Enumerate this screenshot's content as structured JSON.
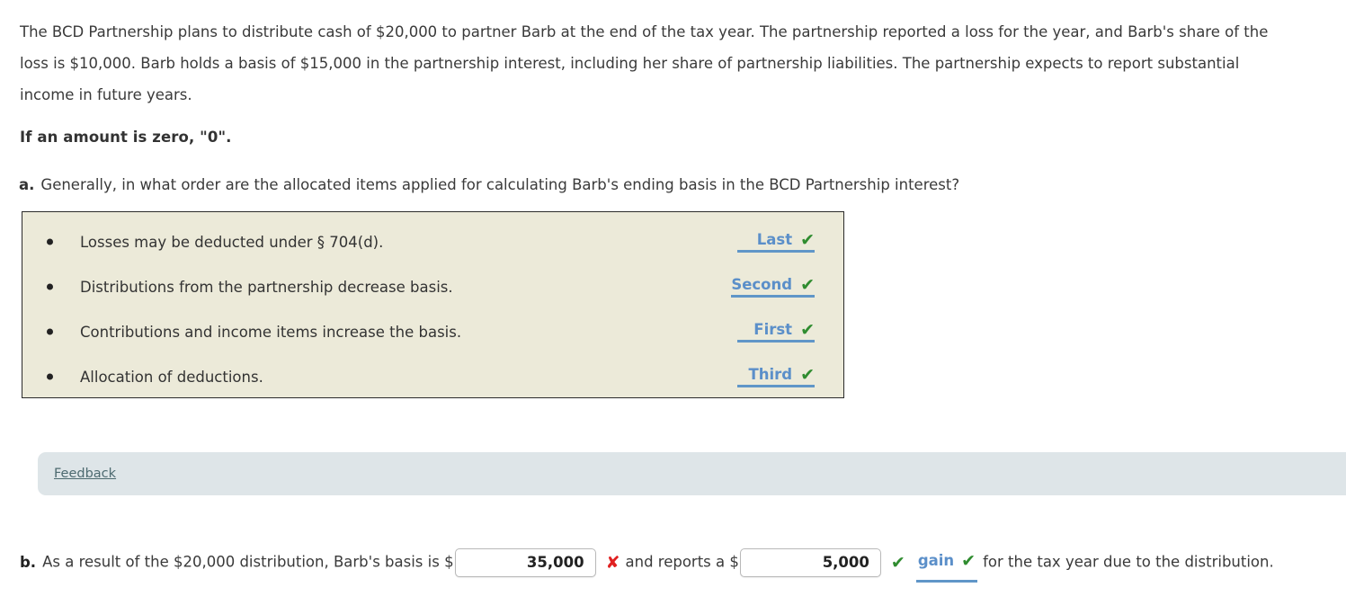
{
  "problem": {
    "intro": "The BCD Partnership plans to distribute cash of $20,000 to partner Barb at the end of the tax year. The partnership reported a loss for the year, and Barb's share of the loss is $10,000. Barb holds a basis of $15,000 in the partnership interest, including her share of partnership liabilities. The partnership expects to report substantial income in future years.",
    "instruction": "If an amount is zero, \"0\"."
  },
  "part_a": {
    "label": "a.",
    "question": "Generally, in what order are the allocated items applied for calculating Barb's ending basis in the BCD Partnership interest?",
    "items": [
      {
        "text": "Losses may be deducted under § 704(d).",
        "answer": "Last",
        "status": "correct",
        "status_glyph": "✔"
      },
      {
        "text": "Distributions from the partnership decrease basis.",
        "answer": "Second",
        "status": "correct",
        "status_glyph": "✔"
      },
      {
        "text": "Contributions and income items increase the basis.",
        "answer": "First",
        "status": "correct",
        "status_glyph": "✔"
      },
      {
        "text": "Allocation of deductions.",
        "answer": "Third",
        "status": "correct",
        "status_glyph": "✔"
      }
    ]
  },
  "feedback": {
    "label": "Feedback"
  },
  "part_b": {
    "label": "b.",
    "text_1": "As a result of the $20,000 distribution, Barb's basis is $",
    "basis_value": "35,000",
    "basis_status_glyph": "✘",
    "text_2": "and reports a $",
    "gain_value": "5,000",
    "gain_status_glyph": "✔",
    "gain_type": "gain",
    "gain_type_status_glyph": "✔",
    "text_3": "for the tax year due to the distribution."
  },
  "colors": {
    "answer_box_bg": "#ECEAD9",
    "answer_box_border": "#2B2B2B",
    "dropdown_blue": "#5B8FC9",
    "dropdown_underline": "#6096C8",
    "check_green": "#2F8C2F",
    "x_red": "#E02020",
    "feedback_bg": "#DEE5E8",
    "feedback_link": "#4D6A70"
  }
}
